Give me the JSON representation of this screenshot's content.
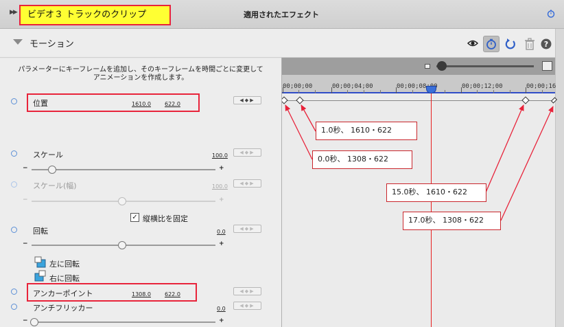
{
  "header": {
    "clip_title": "ビデオ３ トラックのクリップ",
    "panel_title": "適用されたエフェクト"
  },
  "motion": {
    "label": "モーション",
    "toolbar_icons": [
      "eye-icon",
      "clock-icon",
      "reset-icon",
      "trash-icon",
      "help-icon"
    ]
  },
  "description": {
    "line1": "パラメーターにキーフレームを追加し、そのキーフレームを時間ごとに変更して",
    "line2": "アニメーションを作成します。"
  },
  "timeline": {
    "ticks": [
      "00;00;00",
      "00;00;04;00",
      "00;00;08;00",
      "00;00;12;00",
      "00;00;16"
    ]
  },
  "properties": {
    "position": {
      "label": "位置",
      "x": "1610.0",
      "y": "622.0"
    },
    "scale": {
      "label": "スケール",
      "value": "100.0",
      "slider_percent": 10
    },
    "scale_width": {
      "label": "スケール(幅)",
      "value": "100.0",
      "slider_percent": 50
    },
    "lock_aspect": {
      "label": "縦横比を固定",
      "checked": "✓"
    },
    "rotation": {
      "label": "回転",
      "value": "0.0",
      "slider_percent": 50
    },
    "rotate_left": {
      "label": "左に回転"
    },
    "rotate_right": {
      "label": "右に回転"
    },
    "anchor_point": {
      "label": "アンカーポイント",
      "x": "1308.0",
      "y": "622.0"
    },
    "anti_flicker": {
      "label": "アンチフリッカー",
      "value": "0.0",
      "slider_percent": 0
    }
  },
  "keyframe_nav": {
    "prev": "◀",
    "add": "◆",
    "next": "▶"
  },
  "plus": "+",
  "minus": "−",
  "callouts": {
    "kf1": "1.0秒、 1610・622",
    "kf0": "0.0秒、 1308・622",
    "kf15": "15.0秒、 1610・622",
    "kf17": "17.0秒、 1308・622"
  },
  "colors": {
    "highlight_yellow": "#ffff33",
    "annotation_red": "#e8233a",
    "accent_blue": "#2f4cc8",
    "playhead_red": "#e81e1e"
  }
}
